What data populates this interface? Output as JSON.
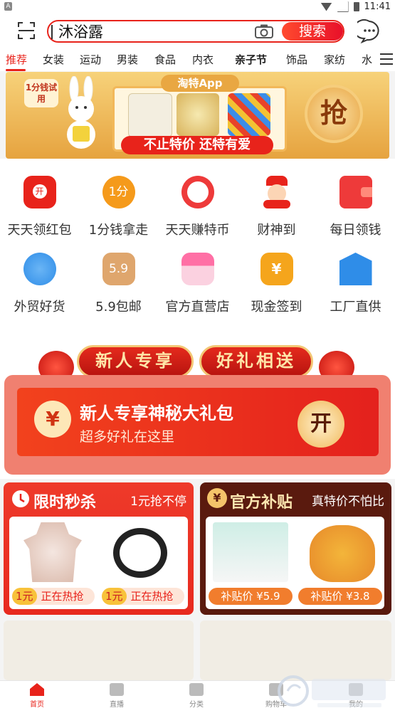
{
  "status_bar": {
    "time": "11:41",
    "notif": "A"
  },
  "search": {
    "query": "沐浴露",
    "button_label": "搜索"
  },
  "tabs": [
    {
      "label": "推荐",
      "active": true
    },
    {
      "label": "女装"
    },
    {
      "label": "运动"
    },
    {
      "label": "男装"
    },
    {
      "label": "食品"
    },
    {
      "label": "内衣"
    },
    {
      "label": "亲子节"
    },
    {
      "label": "饰品"
    },
    {
      "label": "家纺"
    },
    {
      "label": "水"
    }
  ],
  "banner": {
    "app_label": "淘特App",
    "slogan": "不止特价 还特有爱",
    "trial_badge": "1分钱试用",
    "grab_label": "抢"
  },
  "quick_icons": [
    {
      "label": "天天领红包",
      "icon": "red-packet-icon",
      "glyph": "开",
      "color": "#e8231b"
    },
    {
      "label": "1分钱拿走",
      "icon": "one-cent-icon",
      "glyph": "1分",
      "color": "#f59a1b"
    },
    {
      "label": "天天赚特币",
      "icon": "lucky-cat-icon",
      "glyph": "",
      "color": "#ee3a3a"
    },
    {
      "label": "财神到",
      "icon": "fortune-god-icon",
      "glyph": "",
      "color": "#f04a3a"
    },
    {
      "label": "每日领钱",
      "icon": "wallet-icon",
      "glyph": "",
      "color": "#ee3a3a"
    },
    {
      "label": "外贸好货",
      "icon": "globe-plane-icon",
      "glyph": "",
      "color": "#2f8de8"
    },
    {
      "label": "5.9包邮",
      "icon": "package-box-icon",
      "glyph": "5.9",
      "color": "#d99a5c"
    },
    {
      "label": "官方直营店",
      "icon": "store-icon",
      "glyph": "",
      "color": "#f0508a"
    },
    {
      "label": "现金签到",
      "icon": "calendar-coin-icon",
      "glyph": "¥",
      "color": "#f5a51c"
    },
    {
      "label": "工厂直供",
      "icon": "factory-icon",
      "glyph": "",
      "color": "#2f8de8"
    }
  ],
  "newcomer": {
    "ribbon_left": "新人专享",
    "ribbon_right": "好礼相送",
    "yen": "¥",
    "title": "新人专享神秘大礼包",
    "subtitle": "超多好礼在这里",
    "open_label": "开"
  },
  "flash_sale": {
    "title": "限时秒杀",
    "subtitle": "1元抢不停",
    "items": [
      {
        "price": "1元",
        "status": "正在热抢"
      },
      {
        "price": "1元",
        "status": "正在热抢"
      }
    ]
  },
  "subsidy": {
    "title": "官方补贴",
    "subtitle": "真特价不怕比",
    "badge": "¥",
    "items": [
      {
        "price_label": "补贴价 ¥5.9"
      },
      {
        "price_label": "补贴价 ¥3.8"
      }
    ]
  },
  "bottom_nav": [
    {
      "label": "首页",
      "active": true
    },
    {
      "label": "直播"
    },
    {
      "label": "分类"
    },
    {
      "label": "购物车"
    },
    {
      "label": "我的"
    }
  ],
  "colors": {
    "accent": "#e8231b",
    "subsidy_bg": "#5a1a0e"
  }
}
